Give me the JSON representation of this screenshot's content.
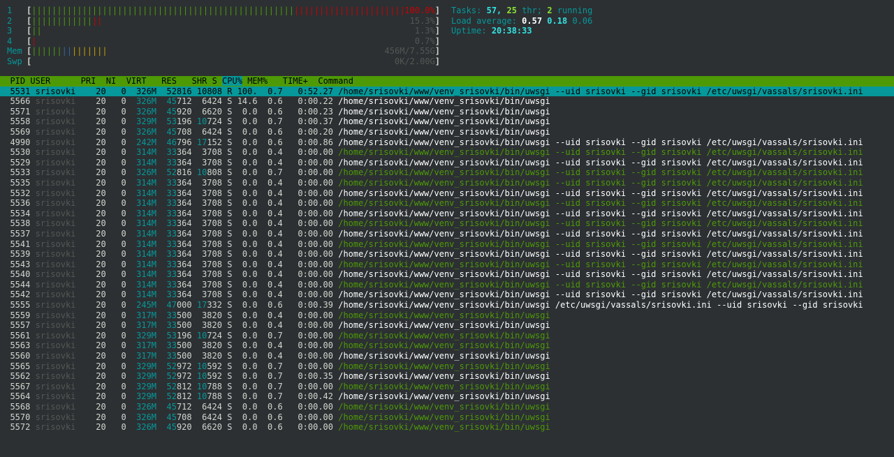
{
  "cpu_meters": [
    {
      "label": "1",
      "value": "100.0%",
      "green": 52,
      "red": 52
    },
    {
      "label": "2",
      "value": "15.3%",
      "green": 12,
      "red": 2
    },
    {
      "label": "3",
      "value": "1.3%",
      "green": 2,
      "red": 0
    },
    {
      "label": "4",
      "value": "0.7%",
      "green": 0,
      "red": 1
    }
  ],
  "mem_meter": {
    "label": "Mem",
    "value": "456M/7.55G"
  },
  "swp_meter": {
    "label": "Swp",
    "value": "0K/2.00G"
  },
  "tasks": {
    "label": "Tasks:",
    "count": "57,",
    "thr": "25",
    "thr_label": "thr;",
    "running": "2",
    "running_label": "running"
  },
  "load": {
    "label": "Load average:",
    "v1": "0.57",
    "v2": "0.18",
    "v3": "0.06"
  },
  "uptime": {
    "label": "Uptime:",
    "value": "20:38:33"
  },
  "header": {
    "pid": "PID",
    "user": "USER",
    "pri": "PRI",
    "ni": "NI",
    "virt": "VIRT",
    "res": "RES",
    "shr": "SHR",
    "s": "S",
    "cpu": "CPU%",
    "mem": "MEM%",
    "time": "TIME+",
    "command": "Command"
  },
  "processes": [
    {
      "pid": "5531",
      "user": "srisovki",
      "pri": "20",
      "ni": "0",
      "virt": "326M",
      "res_hi": "52",
      "res_lo": "816",
      "shr_hi": "10",
      "shr_lo": "808",
      "s": "R",
      "cpu": "100.",
      "mem": "0.7",
      "time": "0:52.27",
      "cmd": "/home/srisovki/www/venv_srisovki/bin/uwsgi",
      "args": "--uid srisovki --gid srisovki /etc/uwsgi/vassals/srisovki.ini",
      "thread": false,
      "selected": true
    },
    {
      "pid": "5566",
      "user": "srisovki",
      "pri": "20",
      "ni": "0",
      "virt": "326M",
      "res_hi": "45",
      "res_lo": "712",
      "shr_hi": "",
      "shr_lo": "6424",
      "s": "S",
      "cpu": "14.6",
      "mem": "0.6",
      "time": "0:00.22",
      "cmd": "/home/srisovki/www/venv_srisovki/bin/uwsgi",
      "args": "",
      "thread": false
    },
    {
      "pid": "5571",
      "user": "srisovki",
      "pri": "20",
      "ni": "0",
      "virt": "326M",
      "res_hi": "45",
      "res_lo": "920",
      "shr_hi": "",
      "shr_lo": "6620",
      "s": "S",
      "cpu": "0.0",
      "mem": "0.6",
      "time": "0:00.23",
      "cmd": "/home/srisovki/www/venv_srisovki/bin/uwsgi",
      "args": "",
      "thread": false
    },
    {
      "pid": "5558",
      "user": "srisovki",
      "pri": "20",
      "ni": "0",
      "virt": "329M",
      "res_hi": "53",
      "res_lo": "196",
      "shr_hi": "10",
      "shr_lo": "724",
      "s": "S",
      "cpu": "0.0",
      "mem": "0.7",
      "time": "0:00.37",
      "cmd": "/home/srisovki/www/venv_srisovki/bin/uwsgi",
      "args": "",
      "thread": false
    },
    {
      "pid": "5569",
      "user": "srisovki",
      "pri": "20",
      "ni": "0",
      "virt": "326M",
      "res_hi": "45",
      "res_lo": "708",
      "shr_hi": "",
      "shr_lo": "6424",
      "s": "S",
      "cpu": "0.0",
      "mem": "0.6",
      "time": "0:00.20",
      "cmd": "/home/srisovki/www/venv_srisovki/bin/uwsgi",
      "args": "",
      "thread": false
    },
    {
      "pid": "4990",
      "user": "srisovki",
      "pri": "20",
      "ni": "0",
      "virt": "242M",
      "res_hi": "46",
      "res_lo": "796",
      "shr_hi": "17",
      "shr_lo": "152",
      "s": "S",
      "cpu": "0.0",
      "mem": "0.6",
      "time": "0:00.86",
      "cmd": "/home/srisovki/www/venv_srisovki/bin/uwsgi",
      "args": "--uid srisovki --gid srisovki /etc/uwsgi/vassals/srisovki.ini",
      "thread": false
    },
    {
      "pid": "5530",
      "user": "srisovki",
      "pri": "20",
      "ni": "0",
      "virt": "314M",
      "res_hi": "33",
      "res_lo": "364",
      "shr_hi": "",
      "shr_lo": "3708",
      "s": "S",
      "cpu": "0.0",
      "mem": "0.4",
      "time": "0:00.00",
      "cmd": "/home/srisovki/www/venv_srisovki/bin/uwsgi",
      "args": "--uid srisovki --gid srisovki /etc/uwsgi/vassals/srisovki.ini",
      "thread": true
    },
    {
      "pid": "5529",
      "user": "srisovki",
      "pri": "20",
      "ni": "0",
      "virt": "314M",
      "res_hi": "33",
      "res_lo": "364",
      "shr_hi": "",
      "shr_lo": "3708",
      "s": "S",
      "cpu": "0.0",
      "mem": "0.4",
      "time": "0:00.00",
      "cmd": "/home/srisovki/www/venv_srisovki/bin/uwsgi",
      "args": "--uid srisovki --gid srisovki /etc/uwsgi/vassals/srisovki.ini",
      "thread": false
    },
    {
      "pid": "5533",
      "user": "srisovki",
      "pri": "20",
      "ni": "0",
      "virt": "326M",
      "res_hi": "52",
      "res_lo": "816",
      "shr_hi": "10",
      "shr_lo": "808",
      "s": "S",
      "cpu": "0.0",
      "mem": "0.7",
      "time": "0:00.00",
      "cmd": "/home/srisovki/www/venv_srisovki/bin/uwsgi",
      "args": "--uid srisovki --gid srisovki /etc/uwsgi/vassals/srisovki.ini",
      "thread": true
    },
    {
      "pid": "5535",
      "user": "srisovki",
      "pri": "20",
      "ni": "0",
      "virt": "314M",
      "res_hi": "33",
      "res_lo": "364",
      "shr_hi": "",
      "shr_lo": "3708",
      "s": "S",
      "cpu": "0.0",
      "mem": "0.4",
      "time": "0:00.00",
      "cmd": "/home/srisovki/www/venv_srisovki/bin/uwsgi",
      "args": "--uid srisovki --gid srisovki /etc/uwsgi/vassals/srisovki.ini",
      "thread": true
    },
    {
      "pid": "5532",
      "user": "srisovki",
      "pri": "20",
      "ni": "0",
      "virt": "314M",
      "res_hi": "33",
      "res_lo": "364",
      "shr_hi": "",
      "shr_lo": "3708",
      "s": "S",
      "cpu": "0.0",
      "mem": "0.4",
      "time": "0:00.00",
      "cmd": "/home/srisovki/www/venv_srisovki/bin/uwsgi",
      "args": "--uid srisovki --gid srisovki /etc/uwsgi/vassals/srisovki.ini",
      "thread": false
    },
    {
      "pid": "5536",
      "user": "srisovki",
      "pri": "20",
      "ni": "0",
      "virt": "314M",
      "res_hi": "33",
      "res_lo": "364",
      "shr_hi": "",
      "shr_lo": "3708",
      "s": "S",
      "cpu": "0.0",
      "mem": "0.4",
      "time": "0:00.00",
      "cmd": "/home/srisovki/www/venv_srisovki/bin/uwsgi",
      "args": "--uid srisovki --gid srisovki /etc/uwsgi/vassals/srisovki.ini",
      "thread": true
    },
    {
      "pid": "5534",
      "user": "srisovki",
      "pri": "20",
      "ni": "0",
      "virt": "314M",
      "res_hi": "33",
      "res_lo": "364",
      "shr_hi": "",
      "shr_lo": "3708",
      "s": "S",
      "cpu": "0.0",
      "mem": "0.4",
      "time": "0:00.00",
      "cmd": "/home/srisovki/www/venv_srisovki/bin/uwsgi",
      "args": "--uid srisovki --gid srisovki /etc/uwsgi/vassals/srisovki.ini",
      "thread": false
    },
    {
      "pid": "5538",
      "user": "srisovki",
      "pri": "20",
      "ni": "0",
      "virt": "314M",
      "res_hi": "33",
      "res_lo": "364",
      "shr_hi": "",
      "shr_lo": "3708",
      "s": "S",
      "cpu": "0.0",
      "mem": "0.4",
      "time": "0:00.00",
      "cmd": "/home/srisovki/www/venv_srisovki/bin/uwsgi",
      "args": "--uid srisovki --gid srisovki /etc/uwsgi/vassals/srisovki.ini",
      "thread": true
    },
    {
      "pid": "5537",
      "user": "srisovki",
      "pri": "20",
      "ni": "0",
      "virt": "314M",
      "res_hi": "33",
      "res_lo": "364",
      "shr_hi": "",
      "shr_lo": "3708",
      "s": "S",
      "cpu": "0.0",
      "mem": "0.4",
      "time": "0:00.00",
      "cmd": "/home/srisovki/www/venv_srisovki/bin/uwsgi",
      "args": "--uid srisovki --gid srisovki /etc/uwsgi/vassals/srisovki.ini",
      "thread": false
    },
    {
      "pid": "5541",
      "user": "srisovki",
      "pri": "20",
      "ni": "0",
      "virt": "314M",
      "res_hi": "33",
      "res_lo": "364",
      "shr_hi": "",
      "shr_lo": "3708",
      "s": "S",
      "cpu": "0.0",
      "mem": "0.4",
      "time": "0:00.00",
      "cmd": "/home/srisovki/www/venv_srisovki/bin/uwsgi",
      "args": "--uid srisovki --gid srisovki /etc/uwsgi/vassals/srisovki.ini",
      "thread": true
    },
    {
      "pid": "5539",
      "user": "srisovki",
      "pri": "20",
      "ni": "0",
      "virt": "314M",
      "res_hi": "33",
      "res_lo": "364",
      "shr_hi": "",
      "shr_lo": "3708",
      "s": "S",
      "cpu": "0.0",
      "mem": "0.4",
      "time": "0:00.00",
      "cmd": "/home/srisovki/www/venv_srisovki/bin/uwsgi",
      "args": "--uid srisovki --gid srisovki /etc/uwsgi/vassals/srisovki.ini",
      "thread": false
    },
    {
      "pid": "5543",
      "user": "srisovki",
      "pri": "20",
      "ni": "0",
      "virt": "314M",
      "res_hi": "33",
      "res_lo": "364",
      "shr_hi": "",
      "shr_lo": "3708",
      "s": "S",
      "cpu": "0.0",
      "mem": "0.4",
      "time": "0:00.00",
      "cmd": "/home/srisovki/www/venv_srisovki/bin/uwsgi",
      "args": "--uid srisovki --gid srisovki /etc/uwsgi/vassals/srisovki.ini",
      "thread": true
    },
    {
      "pid": "5540",
      "user": "srisovki",
      "pri": "20",
      "ni": "0",
      "virt": "314M",
      "res_hi": "33",
      "res_lo": "364",
      "shr_hi": "",
      "shr_lo": "3708",
      "s": "S",
      "cpu": "0.0",
      "mem": "0.4",
      "time": "0:00.00",
      "cmd": "/home/srisovki/www/venv_srisovki/bin/uwsgi",
      "args": "--uid srisovki --gid srisovki /etc/uwsgi/vassals/srisovki.ini",
      "thread": false
    },
    {
      "pid": "5544",
      "user": "srisovki",
      "pri": "20",
      "ni": "0",
      "virt": "314M",
      "res_hi": "33",
      "res_lo": "364",
      "shr_hi": "",
      "shr_lo": "3708",
      "s": "S",
      "cpu": "0.0",
      "mem": "0.4",
      "time": "0:00.00",
      "cmd": "/home/srisovki/www/venv_srisovki/bin/uwsgi",
      "args": "--uid srisovki --gid srisovki /etc/uwsgi/vassals/srisovki.ini",
      "thread": true
    },
    {
      "pid": "5542",
      "user": "srisovki",
      "pri": "20",
      "ni": "0",
      "virt": "314M",
      "res_hi": "33",
      "res_lo": "364",
      "shr_hi": "",
      "shr_lo": "3708",
      "s": "S",
      "cpu": "0.0",
      "mem": "0.4",
      "time": "0:00.00",
      "cmd": "/home/srisovki/www/venv_srisovki/bin/uwsgi",
      "args": "--uid srisovki --gid srisovki /etc/uwsgi/vassals/srisovki.ini",
      "thread": false
    },
    {
      "pid": "5555",
      "user": "srisovki",
      "pri": "20",
      "ni": "0",
      "virt": "245M",
      "res_hi": "47",
      "res_lo": "000",
      "shr_hi": "17",
      "shr_lo": "332",
      "s": "S",
      "cpu": "0.0",
      "mem": "0.6",
      "time": "0:00.39",
      "cmd": "/home/srisovki/www/venv_srisovki/bin/uwsgi",
      "args": "/etc/uwsgi/vassals/srisovki.ini --uid srisovki --gid srisovki",
      "thread": false
    },
    {
      "pid": "5559",
      "user": "srisovki",
      "pri": "20",
      "ni": "0",
      "virt": "317M",
      "res_hi": "33",
      "res_lo": "500",
      "shr_hi": "",
      "shr_lo": "3820",
      "s": "S",
      "cpu": "0.0",
      "mem": "0.4",
      "time": "0:00.00",
      "cmd": "/home/srisovki/www/venv_srisovki/bin/uwsgi",
      "args": "",
      "thread": true
    },
    {
      "pid": "5557",
      "user": "srisovki",
      "pri": "20",
      "ni": "0",
      "virt": "317M",
      "res_hi": "33",
      "res_lo": "500",
      "shr_hi": "",
      "shr_lo": "3820",
      "s": "S",
      "cpu": "0.0",
      "mem": "0.4",
      "time": "0:00.00",
      "cmd": "/home/srisovki/www/venv_srisovki/bin/uwsgi",
      "args": "",
      "thread": false
    },
    {
      "pid": "5561",
      "user": "srisovki",
      "pri": "20",
      "ni": "0",
      "virt": "329M",
      "res_hi": "53",
      "res_lo": "196",
      "shr_hi": "10",
      "shr_lo": "724",
      "s": "S",
      "cpu": "0.0",
      "mem": "0.7",
      "time": "0:00.00",
      "cmd": "/home/srisovki/www/venv_srisovki/bin/uwsgi",
      "args": "",
      "thread": true
    },
    {
      "pid": "5563",
      "user": "srisovki",
      "pri": "20",
      "ni": "0",
      "virt": "317M",
      "res_hi": "33",
      "res_lo": "500",
      "shr_hi": "",
      "shr_lo": "3820",
      "s": "S",
      "cpu": "0.0",
      "mem": "0.4",
      "time": "0:00.00",
      "cmd": "/home/srisovki/www/venv_srisovki/bin/uwsgi",
      "args": "",
      "thread": true
    },
    {
      "pid": "5560",
      "user": "srisovki",
      "pri": "20",
      "ni": "0",
      "virt": "317M",
      "res_hi": "33",
      "res_lo": "500",
      "shr_hi": "",
      "shr_lo": "3820",
      "s": "S",
      "cpu": "0.0",
      "mem": "0.4",
      "time": "0:00.00",
      "cmd": "/home/srisovki/www/venv_srisovki/bin/uwsgi",
      "args": "",
      "thread": false
    },
    {
      "pid": "5565",
      "user": "srisovki",
      "pri": "20",
      "ni": "0",
      "virt": "329M",
      "res_hi": "52",
      "res_lo": "972",
      "shr_hi": "10",
      "shr_lo": "592",
      "s": "S",
      "cpu": "0.0",
      "mem": "0.7",
      "time": "0:00.00",
      "cmd": "/home/srisovki/www/venv_srisovki/bin/uwsgi",
      "args": "",
      "thread": true
    },
    {
      "pid": "5562",
      "user": "srisovki",
      "pri": "20",
      "ni": "0",
      "virt": "329M",
      "res_hi": "52",
      "res_lo": "972",
      "shr_hi": "10",
      "shr_lo": "592",
      "s": "S",
      "cpu": "0.0",
      "mem": "0.7",
      "time": "0:00.35",
      "cmd": "/home/srisovki/www/venv_srisovki/bin/uwsgi",
      "args": "",
      "thread": false
    },
    {
      "pid": "5567",
      "user": "srisovki",
      "pri": "20",
      "ni": "0",
      "virt": "329M",
      "res_hi": "52",
      "res_lo": "812",
      "shr_hi": "10",
      "shr_lo": "788",
      "s": "S",
      "cpu": "0.0",
      "mem": "0.7",
      "time": "0:00.00",
      "cmd": "/home/srisovki/www/venv_srisovki/bin/uwsgi",
      "args": "",
      "thread": true
    },
    {
      "pid": "5564",
      "user": "srisovki",
      "pri": "20",
      "ni": "0",
      "virt": "329M",
      "res_hi": "52",
      "res_lo": "812",
      "shr_hi": "10",
      "shr_lo": "788",
      "s": "S",
      "cpu": "0.0",
      "mem": "0.7",
      "time": "0:00.42",
      "cmd": "/home/srisovki/www/venv_srisovki/bin/uwsgi",
      "args": "",
      "thread": false
    },
    {
      "pid": "5568",
      "user": "srisovki",
      "pri": "20",
      "ni": "0",
      "virt": "326M",
      "res_hi": "45",
      "res_lo": "712",
      "shr_hi": "",
      "shr_lo": "6424",
      "s": "S",
      "cpu": "0.0",
      "mem": "0.6",
      "time": "0:00.00",
      "cmd": "/home/srisovki/www/venv_srisovki/bin/uwsgi",
      "args": "",
      "thread": true
    },
    {
      "pid": "5570",
      "user": "srisovki",
      "pri": "20",
      "ni": "0",
      "virt": "326M",
      "res_hi": "45",
      "res_lo": "708",
      "shr_hi": "",
      "shr_lo": "6424",
      "s": "S",
      "cpu": "0.0",
      "mem": "0.6",
      "time": "0:00.00",
      "cmd": "/home/srisovki/www/venv_srisovki/bin/uwsgi",
      "args": "",
      "thread": true
    },
    {
      "pid": "5572",
      "user": "srisovki",
      "pri": "20",
      "ni": "0",
      "virt": "326M",
      "res_hi": "45",
      "res_lo": "920",
      "shr_hi": "",
      "shr_lo": "6620",
      "s": "S",
      "cpu": "0.0",
      "mem": "0.6",
      "time": "0:00.00",
      "cmd": "/home/srisovki/www/venv_srisovki/bin/uwsgi",
      "args": "",
      "thread": true
    }
  ],
  "colors": {
    "background": "#2c3033",
    "header_bg": "#4e9a06",
    "selected_bg": "#06989a",
    "thread_green": "#4e9a06",
    "label_cyan": "#06989a"
  }
}
